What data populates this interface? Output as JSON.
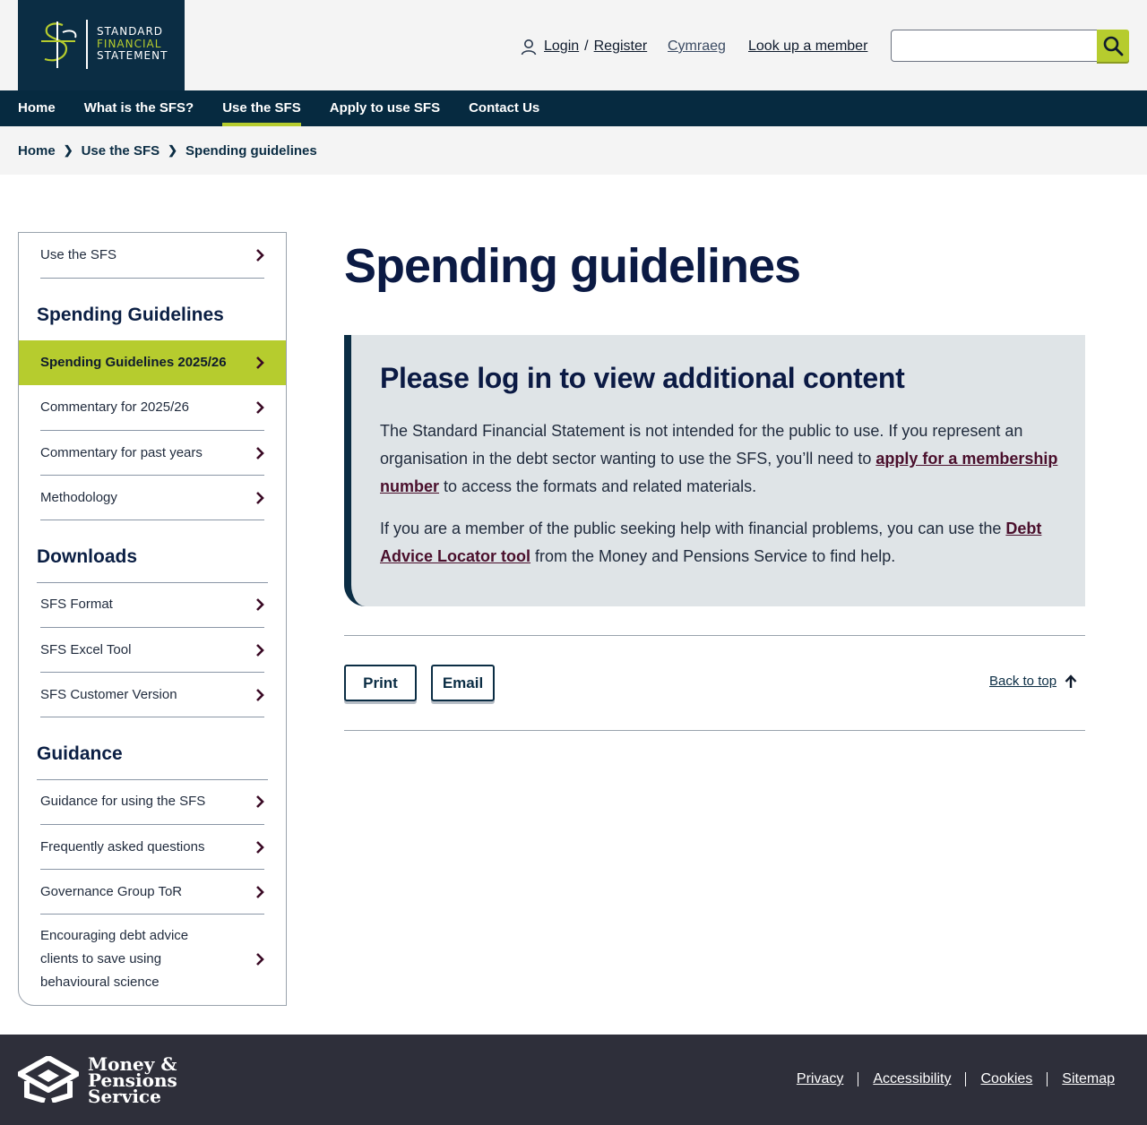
{
  "header": {
    "logo_lines": [
      "STANDARD",
      "FINANCIAL",
      "STATEMENT"
    ],
    "login_label": "Login",
    "register_label": "Register",
    "cymraeg_label": "Cymraeg",
    "lookup_label": "Look up a member",
    "search": {
      "placeholder": "",
      "value": ""
    },
    "icons": {
      "user": "user-icon",
      "search": "search-icon"
    }
  },
  "nav": {
    "items": [
      {
        "label": "Home"
      },
      {
        "label": "What is the SFS?"
      },
      {
        "label": "Use the SFS",
        "active": true
      },
      {
        "label": "Apply to use SFS"
      },
      {
        "label": "Contact Us"
      }
    ]
  },
  "breadcrumb": {
    "items": [
      "Home",
      "Use the SFS",
      "Spending guidelines"
    ]
  },
  "sidebar": {
    "top_item": "Use the SFS",
    "section1": {
      "heading": "Spending Guidelines",
      "items": [
        "Spending Guidelines 2025/26",
        "Commentary for 2025/26",
        "Commentary for past years",
        "Methodology"
      ]
    },
    "section2": {
      "heading": "Downloads",
      "items": [
        "SFS Format",
        "SFS Excel Tool",
        "SFS Customer Version"
      ]
    },
    "section3": {
      "heading": "Guidance",
      "items": [
        "Guidance for using the SFS",
        "Frequently asked questions",
        "Governance Group ToR",
        "Encouraging debt advice clients to save using behavioural science"
      ]
    }
  },
  "main": {
    "title": "Spending guidelines",
    "notice": {
      "heading": "Please log in to view additional content",
      "p1_before": "The Standard Financial Statement is not intended for the public to use. If you represent an organisation in the debt sector wanting to use the SFS, you’ll need to ",
      "p1_link": "apply for a membership number",
      "p1_after": " to access the formats and related materials.",
      "p2_before": "If you are a member of the public seeking help with financial problems, you can use the ",
      "p2_link": "Debt Advice Locator tool",
      "p2_after": " from the Money and Pensions Service to find help."
    },
    "print_label": "Print",
    "email_label": "Email",
    "back_to_top_label": "Back to top"
  },
  "footer": {
    "logo_lines": [
      "Money &",
      "Pensions",
      "Service"
    ],
    "links": [
      "Privacy",
      "Accessibility",
      "Cookies",
      "Sitemap"
    ]
  },
  "colors": {
    "navy": "#062a40",
    "lime": "#b6cc2e",
    "link_maroon": "#4a0f2c",
    "footer_bg": "#2e2f3a",
    "notice_bg": "#dfe4e7"
  }
}
